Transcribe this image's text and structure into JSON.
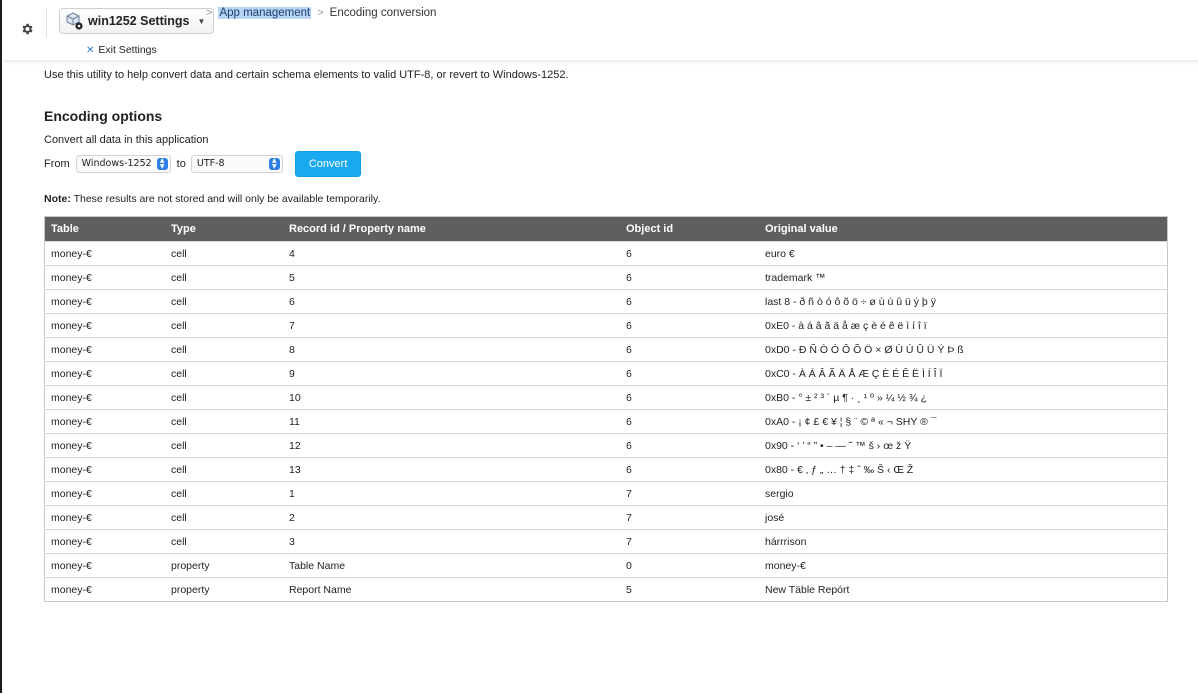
{
  "topbar": {
    "app_name": "win1252 Settings",
    "exit_label": "Exit Settings",
    "breadcrumb": {
      "link": "App management",
      "current": "Encoding conversion"
    }
  },
  "content": {
    "intro": "Use this utility to help convert data and certain schema elements to valid UTF-8, or revert to Windows-1252.",
    "section_title": "Encoding options",
    "subtitle": "Convert all data in this application",
    "from_label": "From",
    "from_value": "Windows-1252",
    "to_label": "to",
    "to_value": "UTF-8",
    "convert_label": "Convert",
    "note_label": "Note:",
    "note_text": " These results are not stored and will only be available temporarily."
  },
  "table": {
    "headers": [
      "Table",
      "Type",
      "Record id / Property name",
      "Object id",
      "Original value"
    ],
    "rows": [
      [
        "money-€",
        "cell",
        "4",
        "6",
        "euro €"
      ],
      [
        "money-€",
        "cell",
        "5",
        "6",
        "trademark ™"
      ],
      [
        "money-€",
        "cell",
        "6",
        "6",
        "last 8 - ð ñ ò ó ô õ ö ÷ ø ù ú û ü ý þ ÿ"
      ],
      [
        "money-€",
        "cell",
        "7",
        "6",
        "0xE0 - à á â ã ä å æ ç è é ê ë ì í î ï"
      ],
      [
        "money-€",
        "cell",
        "8",
        "6",
        "0xD0 - Ð Ñ Ò Ó Ô Õ Ö × Ø Ù Ú Û Ü Ý Þ ß"
      ],
      [
        "money-€",
        "cell",
        "9",
        "6",
        "0xC0 - À Á Â Ã Ä Å Æ Ç È É Ê Ë Ì Í Î Ï"
      ],
      [
        "money-€",
        "cell",
        "10",
        "6",
        "0xB0 - ° ± ² ³ ´ µ ¶ · ¸ ¹ º » ¼ ½ ¾ ¿"
      ],
      [
        "money-€",
        "cell",
        "11",
        "6",
        "0xA0 - ¡ ¢ £ € ¥ ¦ § ¨ © ª « ¬ SHY ® ¯"
      ],
      [
        "money-€",
        "cell",
        "12",
        "6",
        "0x90 - ‘ ’ “ ” • – — ˜ ™ š › œ ž Ÿ"
      ],
      [
        "money-€",
        "cell",
        "13",
        "6",
        "0x80 - € ‚ ƒ „ … † ‡ ˆ ‰ Š ‹ Œ Ž"
      ],
      [
        "money-€",
        "cell",
        "1",
        "7",
        "sergio"
      ],
      [
        "money-€",
        "cell",
        "2",
        "7",
        "josé"
      ],
      [
        "money-€",
        "cell",
        "3",
        "7",
        "hárrrison"
      ],
      [
        "money-€",
        "property",
        "Table Name",
        "0",
        "money-€"
      ],
      [
        "money-€",
        "property",
        "Report Name",
        "5",
        "New Täble Repórt"
      ]
    ]
  }
}
